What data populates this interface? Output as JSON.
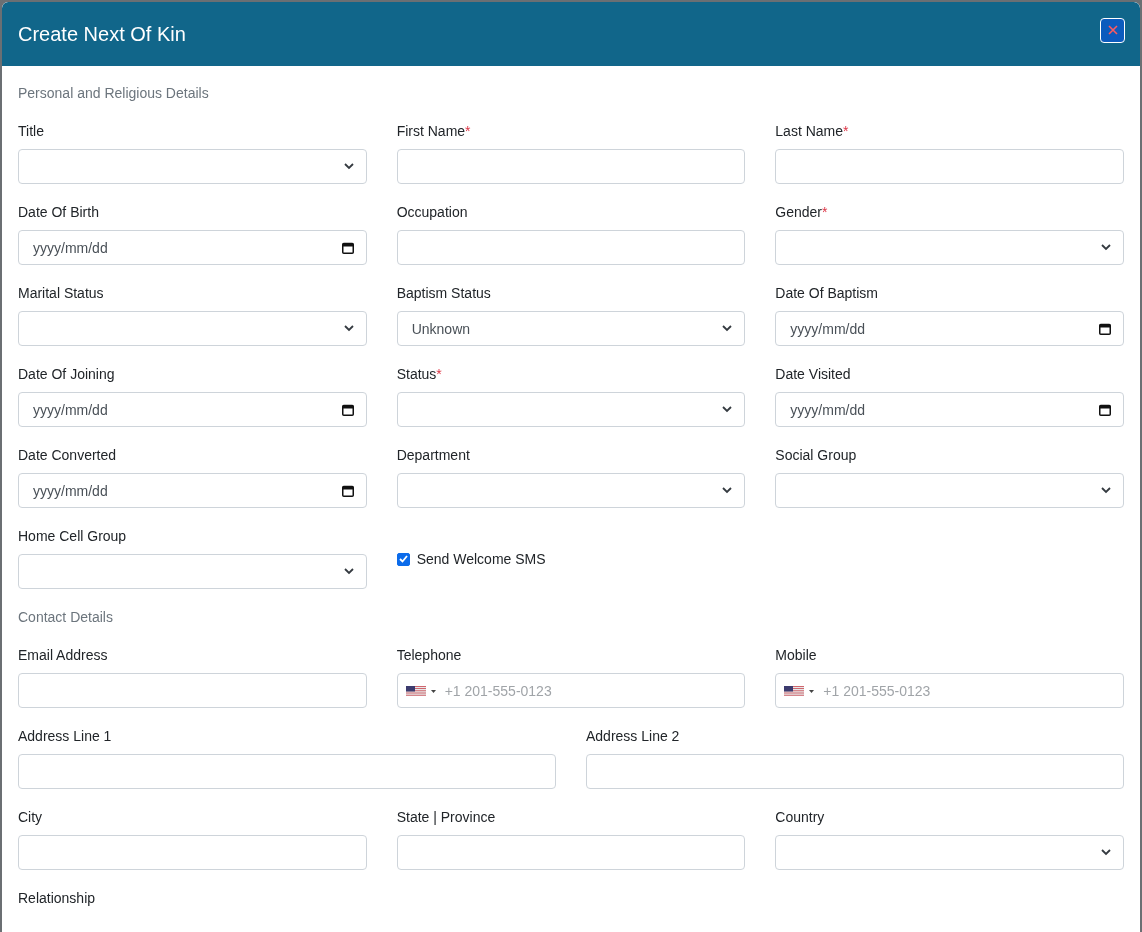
{
  "dialog": {
    "title": "Create Next Of Kin"
  },
  "sections": [
    {
      "title": "Personal and Religious Details",
      "rows": [
        [
          {
            "kind": "select",
            "label": "Title"
          },
          {
            "kind": "text",
            "label": "First Name",
            "required_mark": "*"
          },
          {
            "kind": "text",
            "label": "Last Name",
            "required_mark": "*"
          }
        ],
        [
          {
            "kind": "date",
            "label": "Date Of Birth",
            "placeholder": "yyyy/mm/dd"
          },
          {
            "kind": "text",
            "label": "Occupation"
          },
          {
            "kind": "select",
            "label": "Gender",
            "required_mark": "*"
          }
        ],
        [
          {
            "kind": "select",
            "label": "Marital Status"
          },
          {
            "kind": "select",
            "label": "Baptism Status",
            "value": "Unknown"
          },
          {
            "kind": "date",
            "label": "Date Of Baptism",
            "placeholder": "yyyy/mm/dd"
          }
        ],
        [
          {
            "kind": "date",
            "label": "Date Of Joining",
            "placeholder": "yyyy/mm/dd"
          },
          {
            "kind": "select",
            "label": "Status",
            "required_mark": "*"
          },
          {
            "kind": "date",
            "label": "Date Visited",
            "placeholder": "yyyy/mm/dd"
          }
        ],
        [
          {
            "kind": "date",
            "label": "Date Converted",
            "placeholder": "yyyy/mm/dd"
          },
          {
            "kind": "select",
            "label": "Department"
          },
          {
            "kind": "select",
            "label": "Social Group"
          }
        ],
        [
          {
            "kind": "select",
            "label": "Home Cell Group"
          },
          {
            "kind": "checkbox",
            "label": "Send Welcome SMS",
            "checked": true
          }
        ]
      ]
    },
    {
      "title": "Contact Details",
      "rows": [
        [
          {
            "kind": "text",
            "label": "Email Address"
          },
          {
            "kind": "phone",
            "label": "Telephone",
            "placeholder": "+1 201-555-0123"
          },
          {
            "kind": "phone",
            "label": "Mobile",
            "placeholder": "+1 201-555-0123"
          }
        ],
        [
          {
            "kind": "text",
            "label": "Address Line 1"
          },
          {
            "kind": "text",
            "label": "Address Line 2"
          }
        ],
        [
          {
            "kind": "text",
            "label": "City"
          },
          {
            "kind": "text",
            "label": "State | Province"
          },
          {
            "kind": "select",
            "label": "Country"
          }
        ],
        [
          {
            "kind": "label",
            "label": "Relationship"
          }
        ]
      ]
    }
  ]
}
